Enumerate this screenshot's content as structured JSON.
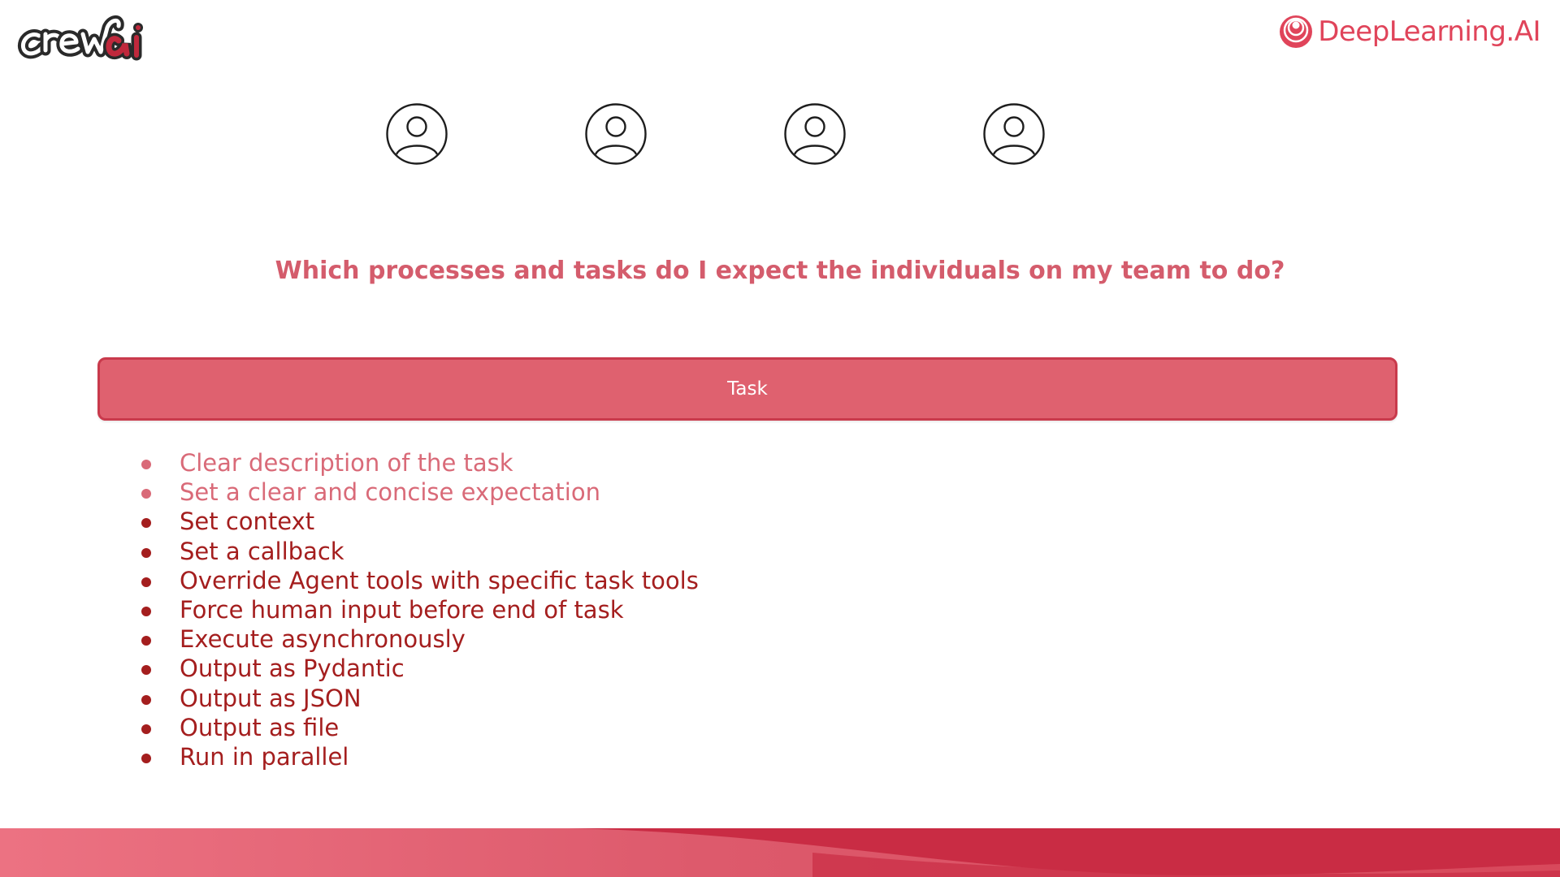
{
  "header": {
    "left_logo": {
      "name": "crewAI",
      "text": "crewai"
    },
    "right_logo": {
      "text": "DeepLearning.AI",
      "color": "#e0445a"
    }
  },
  "agents": {
    "icon": "user-circle-icon",
    "count": 4
  },
  "question": "Which processes and tasks do I expect the individuals on my team to do?",
  "task_bar": {
    "label": "Task",
    "color": "#df616f"
  },
  "bullets": [
    {
      "text": "Clear description of the task",
      "faded": true
    },
    {
      "text": "Set a clear and concise expectation",
      "faded": true
    },
    {
      "text": "Set context",
      "faded": false
    },
    {
      "text": "Set a callback",
      "faded": false
    },
    {
      "text": "Override Agent tools with specific task tools",
      "faded": false
    },
    {
      "text": "Force human input before end of task",
      "faded": false
    },
    {
      "text": "Execute asynchronously",
      "faded": false
    },
    {
      "text": "Output as Pydantic",
      "faded": false
    },
    {
      "text": "Output as JSON",
      "faded": false
    },
    {
      "text": "Output as file",
      "faded": false
    },
    {
      "text": "Run in parallel",
      "faded": false
    }
  ],
  "colors": {
    "accent": "#df616f",
    "bullet_text": "#a41e1e",
    "faded_text": "#d96a78",
    "footer_dark": "#c92c44"
  }
}
